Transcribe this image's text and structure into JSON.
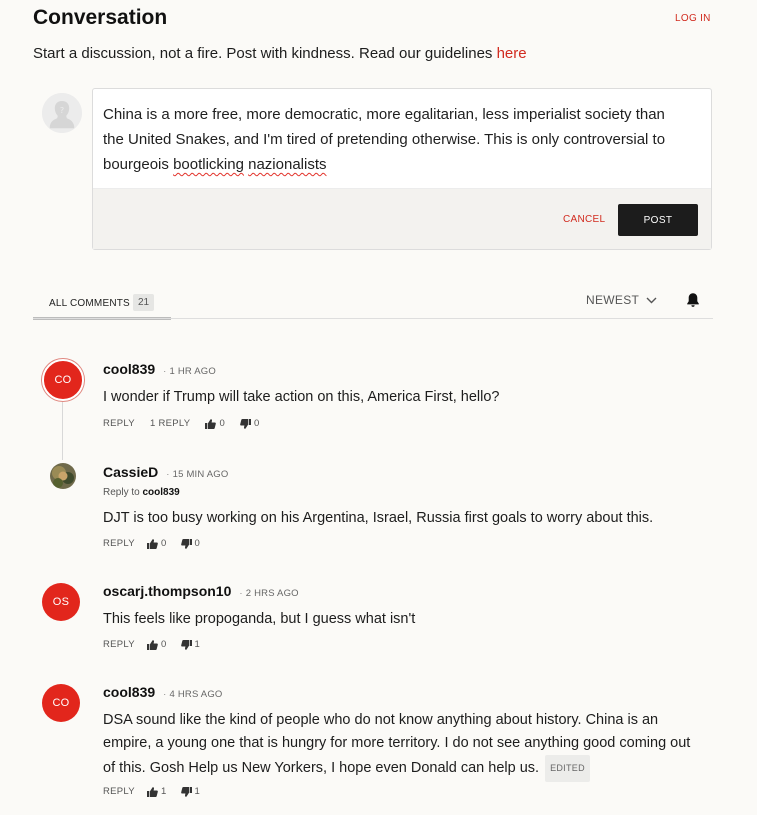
{
  "header": {
    "title": "Conversation",
    "login_label": "LOG IN",
    "tagline": "Start a discussion, not a fire. Post with kindness. Read our guidelines ",
    "guidelines_link": "here"
  },
  "composer": {
    "text_plain": "China is a more free, more democratic, more egalitarian, less imperialist society than the United Snakes, and I'm tired of pretending otherwise. This is only controversial to bourgeois ",
    "misspelled_1": "bootlicking",
    "space": " ",
    "misspelled_2": "nazionalists",
    "cancel_label": "CANCEL",
    "post_label": "POST"
  },
  "tabs": {
    "all_comments_label": "ALL COMMENTS",
    "count": "21",
    "sort_label": "NEWEST"
  },
  "comments": [
    {
      "initials": "CO",
      "author": "cool839",
      "time": "1 HR AGO",
      "text": "I wonder if Trump will take action on this, America First, hello?",
      "reply_label": "REPLY",
      "replies_label": "1 REPLY",
      "likes": "0",
      "dislikes": "0"
    },
    {
      "author": "CassieD",
      "time": "15 MIN AGO",
      "reply_to_prefix": "Reply to ",
      "reply_to_user": "cool839",
      "text": "DJT is too busy working on his Argentina, Israel, Russia first goals to worry about this.",
      "reply_label": "REPLY",
      "likes": "0",
      "dislikes": "0"
    },
    {
      "initials": "OS",
      "author": "oscarj.thompson10",
      "time": "2 HRS AGO",
      "text": "This feels like propoganda, but I guess what isn't",
      "reply_label": "REPLY",
      "likes": "0",
      "dislikes": "1"
    },
    {
      "initials": "CO",
      "author": "cool839",
      "time": "4 HRS AGO",
      "text": "DSA sound like the kind of people who do not know anything about history. China is an empire, a young one that is hungry for more territory. I do not see anything good coming out of this. Gosh Help us New Yorkers, I hope even Donald can help us.",
      "edited_label": "EDITED",
      "reply_label": "REPLY",
      "likes": "1",
      "dislikes": "1"
    }
  ],
  "icons": {
    "guest": "user-silhouette-icon",
    "sort": "chevron-down-icon",
    "bell": "bell-icon",
    "like": "thumbs-up-icon",
    "dislike": "thumbs-down-icon"
  },
  "colors": {
    "accent": "#d12b1f",
    "avatar": "#e2261c",
    "background": "#fbfaf7",
    "post_button": "#1c1c1c"
  }
}
